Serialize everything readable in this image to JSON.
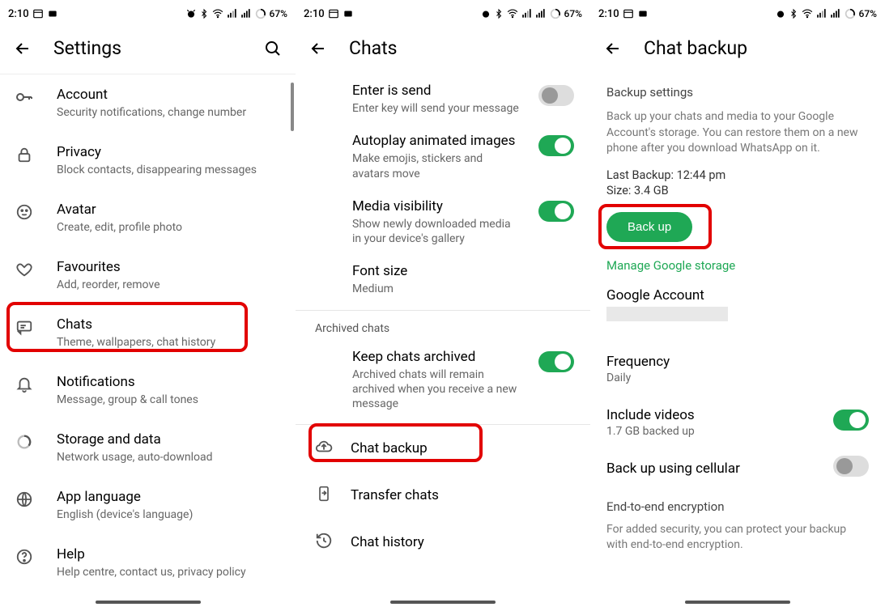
{
  "status": {
    "time": "2:10",
    "battery": "67%"
  },
  "screen1": {
    "title": "Settings",
    "items": [
      {
        "title": "Account",
        "sub": "Security notifications, change number"
      },
      {
        "title": "Privacy",
        "sub": "Block contacts, disappearing messages"
      },
      {
        "title": "Avatar",
        "sub": "Create, edit, profile photo"
      },
      {
        "title": "Favourites",
        "sub": "Add, reorder, remove"
      },
      {
        "title": "Chats",
        "sub": "Theme, wallpapers, chat history"
      },
      {
        "title": "Notifications",
        "sub": "Message, group & call tones"
      },
      {
        "title": "Storage and data",
        "sub": "Network usage, auto-download"
      },
      {
        "title": "App language",
        "sub": "English (device's language)"
      },
      {
        "title": "Help",
        "sub": "Help centre, contact us, privacy policy"
      }
    ]
  },
  "screen2": {
    "title": "Chats",
    "enter_is_send": {
      "title": "Enter is send",
      "sub": "Enter key will send your message"
    },
    "autoplay": {
      "title": "Autoplay animated images",
      "sub": "Make emojis, stickers and avatars move"
    },
    "media_vis": {
      "title": "Media visibility",
      "sub": "Show newly downloaded media in your device's gallery"
    },
    "font_size": {
      "title": "Font size",
      "sub": "Medium"
    },
    "archived_header": "Archived chats",
    "keep_archived": {
      "title": "Keep chats archived",
      "sub": "Archived chats will remain archived when you receive a new message"
    },
    "chat_backup": "Chat backup",
    "transfer": "Transfer chats",
    "history": "Chat history"
  },
  "screen3": {
    "title": "Chat backup",
    "heading": "Backup settings",
    "desc": "Back up your chats and media to your Google Account's storage. You can restore them on a new phone after you download WhatsApp on it.",
    "last_backup": "Last Backup: 12:44 pm",
    "size": "Size: 3.4 GB",
    "backup_btn": "Back up",
    "manage_link": "Manage Google storage",
    "google_account": "Google Account",
    "frequency_title": "Frequency",
    "frequency_value": "Daily",
    "include_videos_title": "Include videos",
    "include_videos_sub": "1.7 GB backed up",
    "cellular": "Back up using cellular",
    "enc_title": "End-to-end encryption",
    "enc_desc": "For added security, you can protect your backup with end-to-end encryption."
  }
}
